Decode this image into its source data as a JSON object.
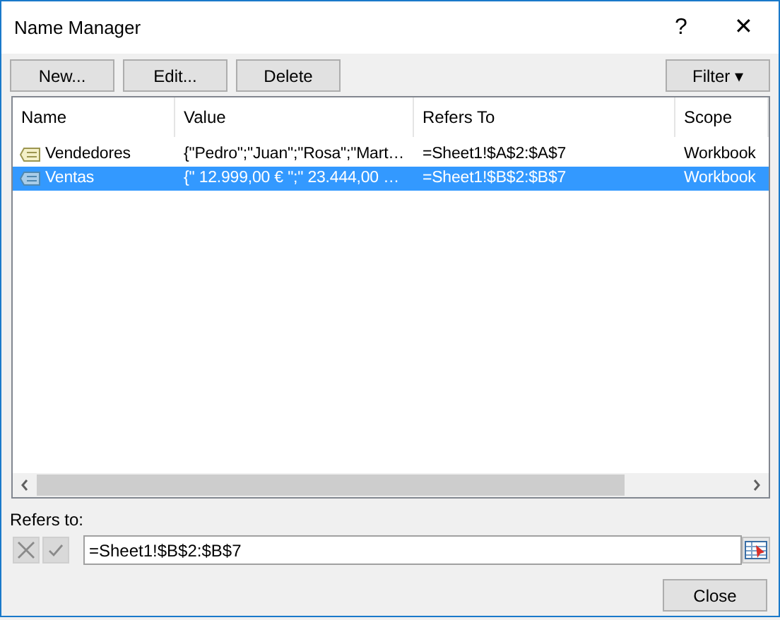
{
  "window": {
    "title": "Name Manager",
    "help": "?",
    "close": "✕"
  },
  "toolbar": [
    "New...",
    "Edit...",
    "Delete"
  ],
  "filter": {
    "label": "Filter",
    "caret": "▾"
  },
  "table": {
    "columns": [
      "Name",
      "Value",
      "Refers To",
      "Scope"
    ],
    "rows": [
      {
        "cells": [
          "Vendedores",
          "{\"Pedro\";\"Juan\";\"Rosa\";\"Mart…",
          "=Sheet1!$A$2:$A$7",
          "Workbook"
        ],
        "selected": false
      },
      {
        "cells": [
          "Ventas",
          "{\" 12.999,00 € \";\" 23.444,00 …",
          "=Sheet1!$B$2:$B$7",
          "Workbook"
        ],
        "selected": true
      }
    ]
  },
  "refers_to": {
    "label": "Refers to:",
    "value": "=Sheet1!$B$2:$B$7",
    "cancel_disabled": true,
    "enter_disabled": true
  },
  "buttons": [
    "Close"
  ]
}
